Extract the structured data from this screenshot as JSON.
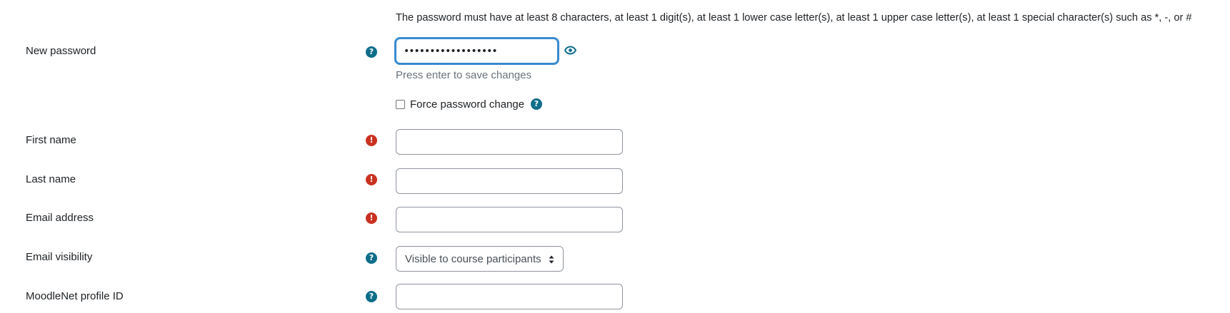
{
  "password_policy": "The password must have at least 8 characters, at least 1 digit(s), at least 1 lower case letter(s), at least 1 upper case letter(s), at least 1 special character(s) such as *, -, or #",
  "new_password": {
    "label": "New password",
    "value": "••••••••••••••••••",
    "hint": "Press enter to save changes",
    "help_icon": "question-mark-icon",
    "reveal_icon": "eye-icon"
  },
  "force_password_change": {
    "label": "Force password change",
    "checked": false,
    "help_icon": "question-mark-icon"
  },
  "first_name": {
    "label": "First name",
    "value": "",
    "required_icon": "exclamation-icon"
  },
  "last_name": {
    "label": "Last name",
    "value": "",
    "required_icon": "exclamation-icon"
  },
  "email_address": {
    "label": "Email address",
    "value": "",
    "required_icon": "exclamation-icon"
  },
  "email_visibility": {
    "label": "Email visibility",
    "selected": "Visible to course participants",
    "help_icon": "question-mark-icon"
  },
  "moodlenet_profile_id": {
    "label": "MoodleNet profile ID",
    "value": "",
    "help_icon": "question-mark-icon"
  },
  "colors": {
    "help_icon": "#0f6d8a",
    "required_icon": "#ca3120",
    "focus_border": "#3a8ad1",
    "input_border": "#8f959e",
    "hint_text": "#6a737b"
  }
}
